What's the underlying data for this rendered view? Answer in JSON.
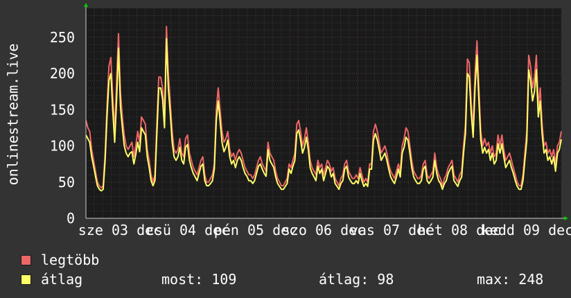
{
  "chart_data": {
    "type": "line",
    "ylabel": "onlinestream.live",
    "ylim": [
      0,
      290
    ],
    "yticks": [
      0,
      50,
      100,
      150,
      200,
      250
    ],
    "xticks": [
      "sze 03 dec",
      "csü 04 dec",
      "pén 05 dec",
      "szo 06 dec",
      "vas 07 dec",
      "hét 08 dec",
      "kedd 09 dec"
    ],
    "grid": true,
    "colors": {
      "background": "#1a1a1a",
      "grid_major": "#5a3a3a",
      "grid_minor": "#3a3a3a",
      "legtobb": "#ee6666",
      "atlag": "#ffff66",
      "arrow": "#00cc00"
    },
    "series": [
      {
        "name": "legtöbb",
        "values": [
          135,
          125,
          120,
          95,
          80,
          65,
          50,
          45,
          42,
          45,
          90,
          155,
          210,
          222,
          170,
          120,
          190,
          255,
          175,
          140,
          115,
          100,
          95,
          100,
          105,
          85,
          100,
          120,
          105,
          140,
          135,
          130,
          95,
          80,
          60,
          50,
          60,
          130,
          195,
          195,
          180,
          140,
          265,
          200,
          160,
          120,
          95,
          90,
          95,
          110,
          90,
          85,
          110,
          115,
          90,
          80,
          70,
          65,
          60,
          70,
          80,
          85,
          60,
          50,
          50,
          55,
          60,
          75,
          150,
          180,
          150,
          120,
          105,
          110,
          120,
          95,
          85,
          90,
          80,
          90,
          95,
          90,
          80,
          70,
          65,
          60,
          60,
          55,
          60,
          70,
          80,
          85,
          75,
          70,
          65,
          105,
          90,
          85,
          80,
          65,
          55,
          50,
          45,
          45,
          50,
          55,
          75,
          70,
          80,
          90,
          130,
          135,
          120,
          100,
          110,
          125,
          105,
          80,
          70,
          65,
          60,
          80,
          70,
          75,
          60,
          70,
          80,
          75,
          65,
          70,
          55,
          50,
          45,
          55,
          60,
          75,
          80,
          65,
          60,
          55,
          55,
          60,
          55,
          70,
          60,
          50,
          55,
          50,
          75,
          75,
          120,
          130,
          120,
          105,
          90,
          95,
          100,
          90,
          75,
          65,
          60,
          55,
          65,
          75,
          65,
          100,
          110,
          125,
          120,
          100,
          80,
          65,
          60,
          55,
          55,
          60,
          75,
          80,
          60,
          55,
          60,
          65,
          90,
          70,
          60,
          55,
          45,
          55,
          60,
          70,
          75,
          80,
          60,
          55,
          50,
          60,
          65,
          100,
          130,
          220,
          215,
          160,
          125,
          200,
          245,
          180,
          120,
          100,
          110,
          100,
          105,
          90,
          100,
          85,
          90,
          115,
          100,
          115,
          95,
          80,
          85,
          90,
          80,
          70,
          60,
          50,
          45,
          45,
          60,
          90,
          120,
          225,
          210,
          180,
          195,
          225,
          155,
          180,
          130,
          100,
          105,
          90,
          95,
          85,
          95,
          75,
          100,
          105,
          120
        ]
      },
      {
        "name": "átlag",
        "values": [
          115,
          110,
          105,
          85,
          72,
          58,
          45,
          40,
          38,
          40,
          80,
          140,
          190,
          200,
          150,
          105,
          165,
          235,
          155,
          125,
          100,
          90,
          85,
          90,
          92,
          75,
          88,
          105,
          92,
          125,
          120,
          115,
          85,
          70,
          52,
          45,
          52,
          115,
          180,
          180,
          165,
          125,
          248,
          180,
          145,
          105,
          85,
          80,
          85,
          98,
          80,
          75,
          98,
          102,
          80,
          70,
          62,
          57,
          52,
          62,
          72,
          75,
          52,
          45,
          45,
          48,
          52,
          68,
          135,
          162,
          135,
          105,
          92,
          98,
          108,
          85,
          75,
          80,
          70,
          80,
          85,
          80,
          70,
          62,
          58,
          52,
          52,
          48,
          52,
          62,
          72,
          75,
          68,
          62,
          58,
          95,
          80,
          75,
          70,
          57,
          48,
          44,
          40,
          40,
          44,
          48,
          68,
          62,
          72,
          80,
          117,
          122,
          108,
          90,
          98,
          112,
          95,
          70,
          62,
          57,
          52,
          72,
          62,
          68,
          52,
          62,
          72,
          68,
          57,
          62,
          48,
          44,
          40,
          48,
          52,
          68,
          72,
          57,
          52,
          48,
          48,
          52,
          48,
          62,
          52,
          44,
          48,
          44,
          68,
          68,
          108,
          117,
          108,
          95,
          80,
          85,
          90,
          80,
          68,
          57,
          52,
          48,
          57,
          68,
          57,
          90,
          98,
          112,
          108,
          90,
          70,
          57,
          52,
          48,
          48,
          52,
          68,
          72,
          52,
          48,
          52,
          57,
          80,
          62,
          52,
          48,
          40,
          48,
          52,
          62,
          68,
          72,
          52,
          48,
          44,
          52,
          57,
          90,
          117,
          200,
          195,
          145,
          112,
          180,
          225,
          162,
          108,
          90,
          98,
          90,
          95,
          80,
          90,
          75,
          80,
          103,
          90,
          103,
          85,
          70,
          75,
          80,
          70,
          62,
          52,
          44,
          40,
          40,
          52,
          80,
          108,
          205,
          190,
          162,
          175,
          205,
          140,
          162,
          117,
          90,
          95,
          80,
          85,
          75,
          85,
          65,
          90,
          95,
          109
        ]
      }
    ]
  },
  "legend": [
    {
      "label": "legtöbb",
      "color": "#ee6666"
    },
    {
      "label": "átlag",
      "color": "#ffff66"
    }
  ],
  "stats": {
    "now": "most: 109",
    "avg": "átlag: 98",
    "max": "max: 248"
  }
}
